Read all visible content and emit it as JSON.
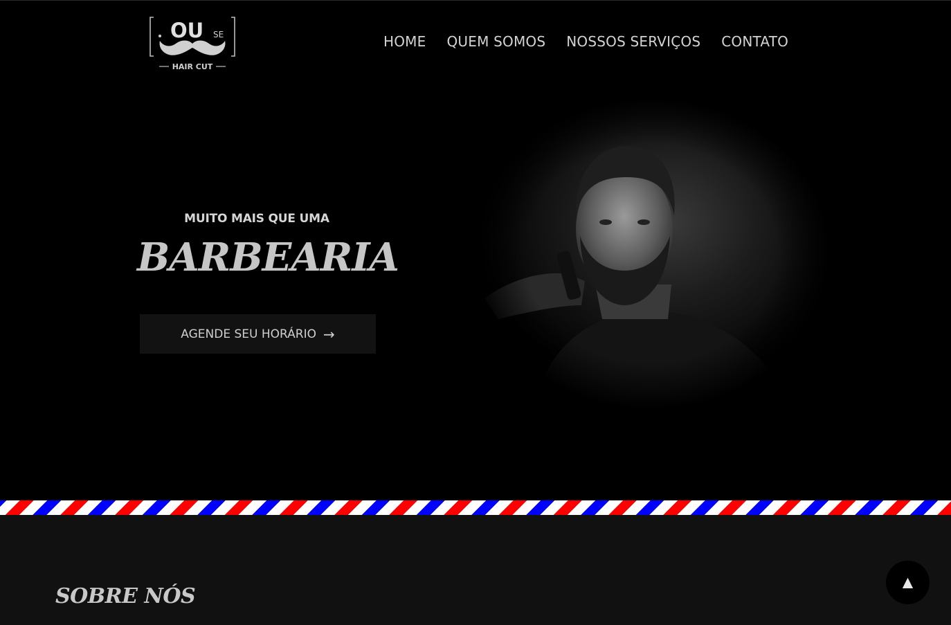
{
  "header": {
    "logo": {
      "main": "OU",
      "small": "SE",
      "tagline": "HAIR CUT"
    },
    "nav": [
      {
        "label": "HOME"
      },
      {
        "label": "QUEM SOMOS"
      },
      {
        "label": "NOSSOS SERVIÇOS"
      },
      {
        "label": "CONTATO"
      }
    ]
  },
  "hero": {
    "eyebrow": "MUITO MAIS QUE UMA",
    "title": "BARBEARIA",
    "cta_label": "AGENDE SEU HORÁRIO",
    "cta_arrow": "→"
  },
  "about": {
    "title": "SOBRE NÓS"
  },
  "back_to_top": {
    "glyph": "▲"
  },
  "colors": {
    "background": "#000000",
    "section_background": "#111111",
    "stripe_red": "#ff0000",
    "stripe_blue": "#0000ff",
    "stripe_white": "#ffffff",
    "text": "#d4d4d4"
  },
  "icons": {
    "logo": "mustache-logo",
    "cta": "arrow-right-icon",
    "back_to_top": "arrow-up-icon"
  }
}
